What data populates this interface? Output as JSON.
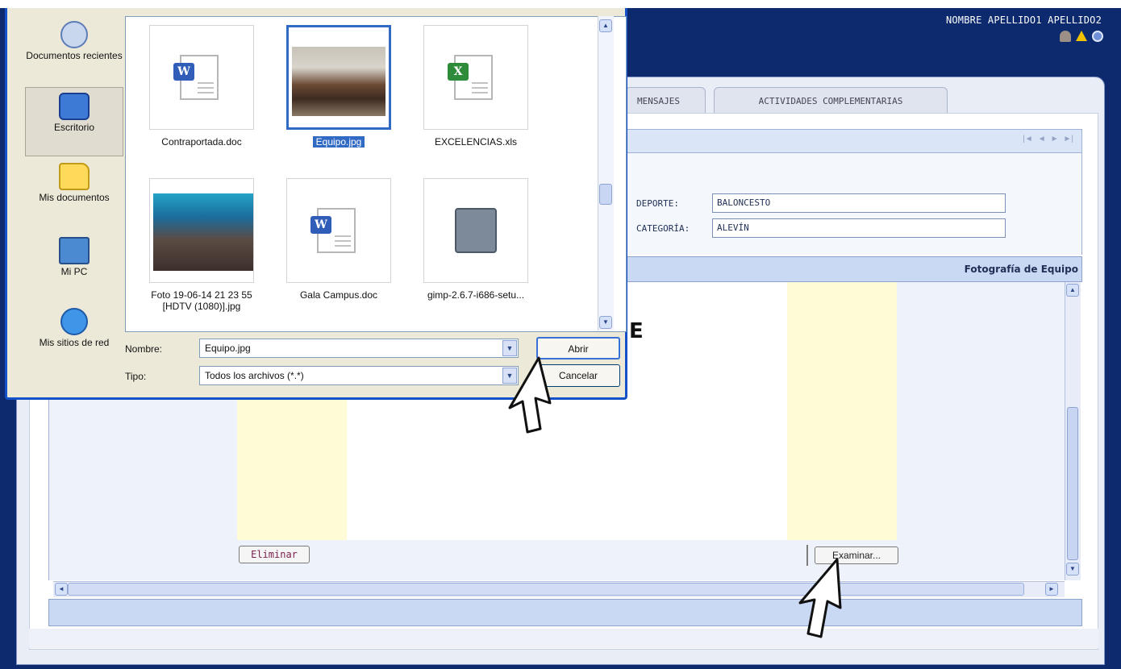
{
  "app": {
    "user_name": "NOMBRE APELLIDO1 APELLIDO2",
    "tabs": [
      {
        "label": "MENSAJES"
      },
      {
        "label": "ACTIVIDADES COMPLEMENTARIAS"
      }
    ],
    "record_nav": [
      "|◄",
      "◄",
      "►",
      "►|"
    ],
    "form": {
      "deporte_label": "DEPORTE:",
      "deporte_value": "BALONCESTO",
      "categoria_label": "CATEGORÍA:",
      "categoria_value": "ALEVÍN"
    },
    "photo_section_title": "Fotografía de Equipo",
    "eliminar_label": "Eliminar",
    "examinar_label": "Examinar...",
    "partial_letter": "E"
  },
  "dialog": {
    "places": [
      {
        "label": "Documentos recientes",
        "icon": "recent-documents-icon"
      },
      {
        "label": "Escritorio",
        "icon": "desktop-icon"
      },
      {
        "label": "Mis documentos",
        "icon": "my-documents-icon"
      },
      {
        "label": "Mi PC",
        "icon": "my-computer-icon"
      },
      {
        "label": "Mis sitios de red",
        "icon": "network-places-icon"
      }
    ],
    "files": [
      {
        "name": "Contraportada.doc",
        "type": "word"
      },
      {
        "name": "Equipo.jpg",
        "type": "photo",
        "selected": true
      },
      {
        "name": "EXCELENCIAS.xls",
        "type": "excel"
      },
      {
        "name": "Foto 19-06-14 21 23 55 [HDTV (1080)].jpg",
        "type": "photo"
      },
      {
        "name": "Gala Campus.doc",
        "type": "word"
      },
      {
        "name": "gimp-2.6.7-i686-setu...",
        "type": "installer"
      }
    ],
    "nombre_label": "Nombre:",
    "nombre_value": "Equipo.jpg",
    "tipo_label": "Tipo:",
    "tipo_value": "Todos los archivos (*.*)",
    "open_label": "Abrir",
    "cancel_label": "Cancelar"
  },
  "colors": {
    "header_blue": "#0d2a6e",
    "selection_blue": "#316ac5",
    "highlight_yellow": "#fefbd6"
  }
}
